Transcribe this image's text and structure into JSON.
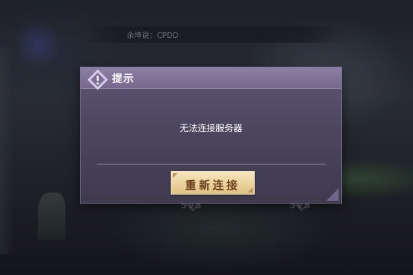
{
  "background": {
    "chat_message": "余坤说：CPDD",
    "mode_left_label": "5V5",
    "mode_right_label": "5V5"
  },
  "dialog": {
    "title": "提示",
    "icon": "exclamation-diamond-icon",
    "message": "无法连接服务器",
    "button_label": "重新连接"
  },
  "colors": {
    "dialog_bg": "#4d465f",
    "header_bg": "#8b80a3",
    "button_bg": "#ead29b",
    "button_text": "#6b3f1e"
  }
}
